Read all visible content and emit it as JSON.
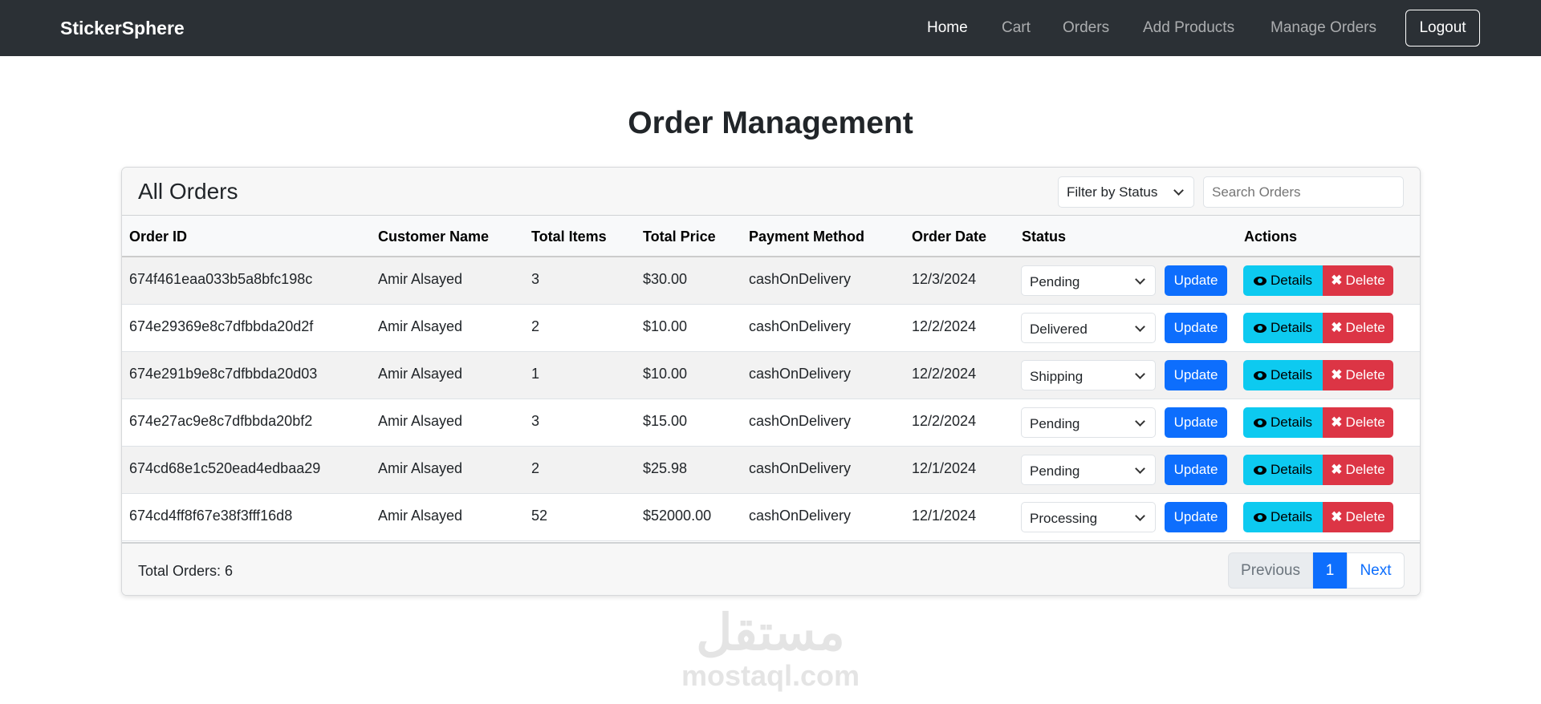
{
  "nav": {
    "brand": "StickerSphere",
    "links": [
      "Home",
      "Cart",
      "Orders",
      "Add Products",
      "Manage Orders"
    ],
    "logout": "Logout"
  },
  "page_title": "Order Management",
  "card": {
    "title": "All Orders",
    "filter": "Filter by Status",
    "search_placeholder": "Search Orders"
  },
  "columns": [
    "Order ID",
    "Customer Name",
    "Total Items",
    "Total Price",
    "Payment Method",
    "Order Date",
    "Status",
    "Actions"
  ],
  "orders": [
    {
      "id": "674f461eaa033b5a8bfc198c",
      "customer": "Amir Alsayed",
      "items": "3",
      "price": "$30.00",
      "payment": "cashOnDelivery",
      "date": "12/3/2024",
      "status": "Pending"
    },
    {
      "id": "674e29369e8c7dfbbda20d2f",
      "customer": "Amir Alsayed",
      "items": "2",
      "price": "$10.00",
      "payment": "cashOnDelivery",
      "date": "12/2/2024",
      "status": "Delivered"
    },
    {
      "id": "674e291b9e8c7dfbbda20d03",
      "customer": "Amir Alsayed",
      "items": "1",
      "price": "$10.00",
      "payment": "cashOnDelivery",
      "date": "12/2/2024",
      "status": "Shipping"
    },
    {
      "id": "674e27ac9e8c7dfbbda20bf2",
      "customer": "Amir Alsayed",
      "items": "3",
      "price": "$15.00",
      "payment": "cashOnDelivery",
      "date": "12/2/2024",
      "status": "Pending"
    },
    {
      "id": "674cd68e1c520ead4edbaa29",
      "customer": "Amir Alsayed",
      "items": "2",
      "price": "$25.98",
      "payment": "cashOnDelivery",
      "date": "12/1/2024",
      "status": "Pending"
    },
    {
      "id": "674cd4ff8f67e38f3fff16d8",
      "customer": "Amir Alsayed",
      "items": "52",
      "price": "$52000.00",
      "payment": "cashOnDelivery",
      "date": "12/1/2024",
      "status": "Processing"
    }
  ],
  "buttons": {
    "update": "Update",
    "details": "Details",
    "delete": "Delete"
  },
  "footer": {
    "total": "Total Orders: 6",
    "previous": "Previous",
    "page": "1",
    "next": "Next"
  },
  "watermark": {
    "arabic": "مستقل",
    "latin": "mostaql.com"
  }
}
